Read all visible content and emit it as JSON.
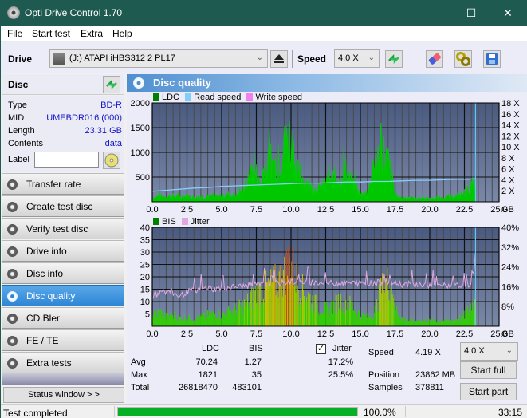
{
  "window": {
    "title": "Opti Drive Control 1.70",
    "controls": {
      "minimize": "—",
      "maximize": "☐",
      "close": "✕"
    }
  },
  "menu": [
    "File",
    "Start test",
    "Extra",
    "Help"
  ],
  "toolbar": {
    "drive_label": "Drive",
    "drive_value": "(J:)  ATAPI iHBS312   2 PL17",
    "speed_label": "Speed",
    "speed_value": "4.0 X",
    "icons": [
      "eject-icon",
      "refresh-icon",
      "eraser-icon",
      "settings-icon",
      "save-icon"
    ]
  },
  "disc": {
    "header": "Disc",
    "fields": [
      {
        "key": "Type",
        "value": "BD-R"
      },
      {
        "key": "MID",
        "value": "UMEBDR016 (000)"
      },
      {
        "key": "Length",
        "value": "23.31 GB"
      },
      {
        "key": "Contents",
        "value": "data"
      }
    ],
    "label_key": "Label",
    "label_value": ""
  },
  "nav": [
    {
      "label": "Transfer rate",
      "active": false
    },
    {
      "label": "Create test disc",
      "active": false
    },
    {
      "label": "Verify test disc",
      "active": false
    },
    {
      "label": "Drive info",
      "active": false
    },
    {
      "label": "Disc info",
      "active": false
    },
    {
      "label": "Disc quality",
      "active": true
    },
    {
      "label": "CD Bler",
      "active": false
    },
    {
      "label": "FE / TE",
      "active": false
    },
    {
      "label": "Extra tests",
      "active": false
    }
  ],
  "status_window_button": "Status window > >",
  "panel": {
    "title": "Disc quality"
  },
  "chart_data": [
    {
      "type": "area",
      "title": "LDC / Read speed",
      "legend": [
        "LDC",
        "Read speed",
        "Write speed"
      ],
      "legend_colors": {
        "LDC": "#008000",
        "Read speed": "#7fd0f8",
        "Write speed": "#f080f0"
      },
      "legend_placement": "top-left",
      "x_label": "GB",
      "x_ticks": [
        "0.0",
        "2.5",
        "5.0",
        "7.5",
        "10.0",
        "12.5",
        "15.0",
        "17.5",
        "20.0",
        "22.5",
        "25.0"
      ],
      "xlim": [
        0,
        25
      ],
      "y_left_ticks": [
        "500",
        "1000",
        "1500",
        "2000"
      ],
      "ylim_left": [
        0,
        2000
      ],
      "y_right_ticks": [
        "2 X",
        "4 X",
        "6 X",
        "8 X",
        "10 X",
        "12 X",
        "14 X",
        "16 X",
        "18 X"
      ],
      "ylim_right": [
        0,
        18
      ],
      "grid": true,
      "ldc": {
        "x": [
          0,
          0.5,
          1,
          1.5,
          2,
          2.5,
          3,
          3.5,
          4,
          4.5,
          5,
          5.5,
          6,
          6.5,
          7,
          7.2,
          7.5,
          7.8,
          8,
          8.5,
          9,
          9.3,
          9.5,
          9.8,
          10,
          10.2,
          10.5,
          11,
          11.5,
          12,
          12.5,
          13,
          13.5,
          14,
          14.5,
          15,
          15.5,
          16,
          16.3,
          16.6,
          17,
          17.3,
          17.5,
          18,
          18.5,
          19,
          19.5,
          20,
          20.5,
          21,
          21.5,
          22,
          22.5,
          23,
          23.3
        ],
        "y": [
          120,
          150,
          140,
          160,
          130,
          170,
          120,
          140,
          150,
          130,
          160,
          200,
          180,
          250,
          700,
          900,
          750,
          400,
          850,
          1100,
          1000,
          1300,
          1500,
          1821,
          1650,
          1400,
          800,
          600,
          400,
          350,
          500,
          650,
          700,
          900,
          450,
          200,
          250,
          900,
          1200,
          1400,
          1100,
          600,
          150,
          100,
          120,
          90,
          110,
          80,
          100,
          120,
          130,
          160,
          250,
          400,
          600
        ]
      },
      "read_speed_x": {
        "x": [
          0,
          1,
          2,
          3,
          4,
          5,
          6,
          7,
          8,
          9,
          10,
          11,
          12,
          13,
          14,
          15,
          16,
          17,
          18,
          19,
          20,
          21,
          22,
          22.8,
          23.3
        ],
        "y": [
          1.9,
          2.1,
          2.3,
          2.5,
          2.6,
          2.8,
          2.9,
          3.0,
          3.1,
          3.2,
          3.3,
          3.4,
          3.4,
          3.5,
          3.6,
          3.6,
          3.7,
          3.7,
          3.8,
          3.9,
          3.9,
          4.0,
          4.1,
          4.1,
          4.19
        ]
      }
    },
    {
      "type": "area",
      "title": "BIS / Jitter",
      "legend": [
        "BIS",
        "Jitter"
      ],
      "legend_colors": {
        "BIS": "#008000",
        "Jitter": "#e0a0e0"
      },
      "legend_placement": "top-left",
      "x_label": "GB",
      "x_ticks": [
        "0.0",
        "2.5",
        "5.0",
        "7.5",
        "10.0",
        "12.5",
        "15.0",
        "17.5",
        "20.0",
        "22.5",
        "25.0"
      ],
      "xlim": [
        0,
        25
      ],
      "y_left_ticks": [
        "5",
        "10",
        "15",
        "20",
        "25",
        "30",
        "35",
        "40"
      ],
      "ylim_left": [
        0,
        40
      ],
      "y_right_ticks": [
        "8%",
        "16%",
        "24%",
        "32%",
        "40%"
      ],
      "ylim_right": [
        0,
        40
      ],
      "grid": true,
      "bis": {
        "x": [
          0,
          0.5,
          1,
          1.5,
          2,
          2.5,
          3,
          3.5,
          4,
          4.5,
          5,
          5.5,
          6,
          6.5,
          7,
          7.5,
          8,
          8.5,
          9,
          9.5,
          9.8,
          10,
          10.2,
          10.5,
          11,
          11.5,
          12,
          12.5,
          13,
          13.5,
          14,
          14.5,
          15,
          15.5,
          16,
          16.5,
          17,
          17.3,
          17.5,
          18,
          18.5,
          19,
          19.5,
          20,
          20.5,
          21,
          21.5,
          22,
          22.5,
          23,
          23.3
        ],
        "y": [
          6,
          8,
          5,
          6,
          4,
          5,
          4,
          5,
          6,
          7,
          6,
          8,
          9,
          11,
          14,
          18,
          20,
          22,
          24,
          28,
          35,
          33,
          30,
          22,
          18,
          14,
          10,
          9,
          11,
          14,
          13,
          10,
          6,
          5,
          8,
          20,
          24,
          22,
          10,
          4,
          3,
          3,
          3,
          3,
          3,
          3,
          3,
          4,
          6,
          12,
          19
        ]
      },
      "jitter_pct": {
        "x": [
          0,
          0.5,
          1,
          1.5,
          2,
          2.5,
          3,
          3.5,
          4,
          4.5,
          5,
          6,
          7,
          8,
          9,
          10,
          11,
          12,
          13,
          14,
          15,
          16,
          17,
          18,
          19,
          20,
          21,
          22,
          23,
          23.3
        ],
        "y": [
          12,
          13.5,
          14,
          13.5,
          12,
          14,
          14.5,
          15,
          15.5,
          15,
          15.5,
          16,
          16.5,
          17,
          17.5,
          18,
          18,
          17.5,
          17.5,
          17.5,
          17.5,
          17.5,
          18,
          17,
          17,
          16.5,
          16.5,
          16.5,
          17,
          25.5
        ]
      }
    }
  ],
  "stats": {
    "columns": [
      "LDC",
      "BIS"
    ],
    "rows": [
      {
        "label": "Avg",
        "ldc": "70.24",
        "bis": "1.27",
        "jitter": "17.2%"
      },
      {
        "label": "Max",
        "ldc": "1821",
        "bis": "35",
        "jitter": "25.5%"
      },
      {
        "label": "Total",
        "ldc": "26818470",
        "bis": "483101",
        "jitter": ""
      }
    ],
    "jitter_label": "Jitter",
    "jitter_checked": true,
    "speed_label": "Speed",
    "speed_value": "4.19 X",
    "position_label": "Position",
    "position_value": "23862 MB",
    "samples_label": "Samples",
    "samples_value": "378811",
    "speed_select": "4.0 X",
    "start_full": "Start full",
    "start_part": "Start part"
  },
  "status": {
    "text": "Test completed",
    "progress_pct": 100.0,
    "progress_label": "100.0%",
    "elapsed": "33:15"
  }
}
